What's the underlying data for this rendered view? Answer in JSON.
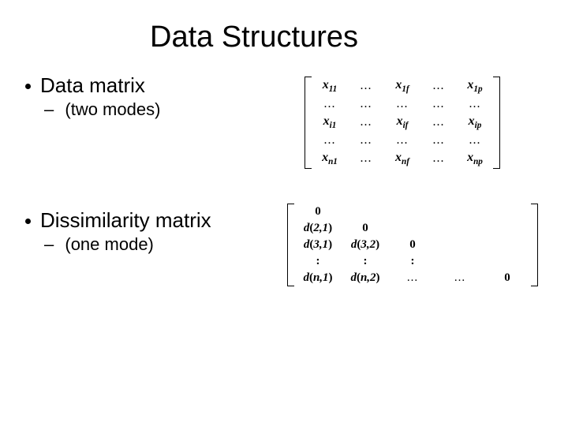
{
  "title": "Data Structures",
  "items": [
    {
      "main": "Data matrix",
      "sub": "(two modes)"
    },
    {
      "main": "Dissimilarity matrix",
      "sub": "(one mode)"
    }
  ],
  "data_matrix": {
    "rows": [
      [
        {
          "t": "var",
          "v": "x",
          "s": "11"
        },
        {
          "t": "dots"
        },
        {
          "t": "var",
          "v": "x",
          "s": "1f"
        },
        {
          "t": "dots"
        },
        {
          "t": "var",
          "v": "x",
          "s": "1p"
        }
      ],
      [
        {
          "t": "dots"
        },
        {
          "t": "dots"
        },
        {
          "t": "dots"
        },
        {
          "t": "dots"
        },
        {
          "t": "dots"
        }
      ],
      [
        {
          "t": "var",
          "v": "x",
          "s": "i1"
        },
        {
          "t": "dots"
        },
        {
          "t": "var",
          "v": "x",
          "s": "if"
        },
        {
          "t": "dots"
        },
        {
          "t": "var",
          "v": "x",
          "s": "ip"
        }
      ],
      [
        {
          "t": "dots"
        },
        {
          "t": "dots"
        },
        {
          "t": "dots"
        },
        {
          "t": "dots"
        },
        {
          "t": "dots"
        }
      ],
      [
        {
          "t": "var",
          "v": "x",
          "s": "n1"
        },
        {
          "t": "dots"
        },
        {
          "t": "var",
          "v": "x",
          "s": "nf"
        },
        {
          "t": "dots"
        },
        {
          "t": "var",
          "v": "x",
          "s": "np"
        }
      ]
    ]
  },
  "dissimilarity_matrix": {
    "rows": [
      [
        {
          "t": "zero"
        },
        {
          "t": "empty"
        },
        {
          "t": "empty"
        },
        {
          "t": "empty"
        },
        {
          "t": "empty"
        }
      ],
      [
        {
          "t": "fun",
          "v": "d",
          "a": "2,1"
        },
        {
          "t": "zero"
        },
        {
          "t": "empty"
        },
        {
          "t": "empty"
        },
        {
          "t": "empty"
        }
      ],
      [
        {
          "t": "fun",
          "v": "d",
          "a": "3,1"
        },
        {
          "t": "fun",
          "v": "d",
          "a": "3,2"
        },
        {
          "t": "zero"
        },
        {
          "t": "empty"
        },
        {
          "t": "empty"
        }
      ],
      [
        {
          "t": "colon"
        },
        {
          "t": "colon"
        },
        {
          "t": "colon"
        },
        {
          "t": "empty"
        },
        {
          "t": "empty"
        }
      ],
      [
        {
          "t": "fun",
          "v": "d",
          "a": "n,1"
        },
        {
          "t": "fun",
          "v": "d",
          "a": "n,2"
        },
        {
          "t": "dots"
        },
        {
          "t": "dots"
        },
        {
          "t": "zero"
        }
      ]
    ]
  }
}
